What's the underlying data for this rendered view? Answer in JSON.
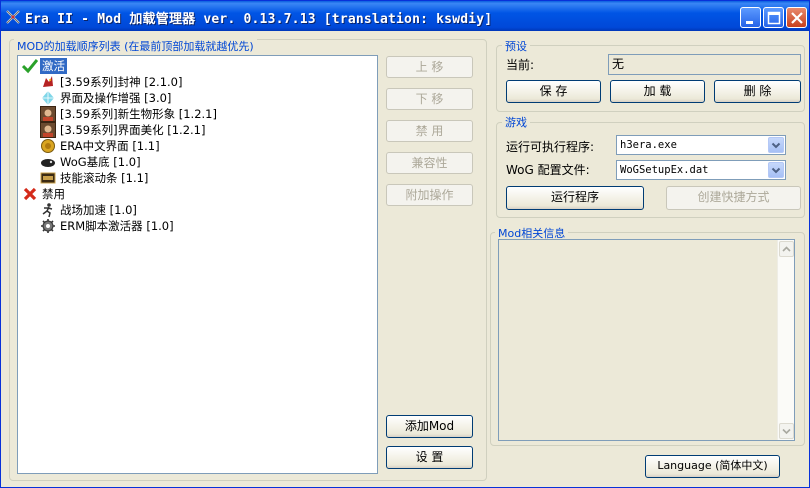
{
  "window": {
    "title": "Era II - Mod 加载管理器 ver. 0.13.7.13 [translation: kswdiy]"
  },
  "mod_list": {
    "group_label": "MOD的加载顺序列表 (在最前顶部加载就越优先)",
    "active": {
      "label": "激活",
      "icon": "green-check-icon",
      "items": [
        {
          "label": "[3.59系列]封神 [2.1.0]",
          "icon": "dragon-icon"
        },
        {
          "label": "界面及操作增强 [3.0]",
          "icon": "crystal-icon"
        },
        {
          "label": "[3.59系列]新生物形象 [1.2.1]",
          "icon": "portrait-icon"
        },
        {
          "label": "[3.59系列]界面美化 [1.2.1]",
          "icon": "portrait-icon"
        },
        {
          "label": "ERA中文界面 [1.1]",
          "icon": "gold-coin-icon"
        },
        {
          "label": "WoG基底 [1.0]",
          "icon": "dark-creature-icon"
        },
        {
          "label": "技能滚动条 [1.1]",
          "icon": "scroll-bar-icon"
        }
      ]
    },
    "disabled": {
      "label": "禁用",
      "icon": "red-x-icon",
      "items": [
        {
          "label": "战场加速 [1.0]",
          "icon": "running-man-icon"
        },
        {
          "label": "ERM脚本激活器 [1.0]",
          "icon": "gear-icon"
        }
      ]
    }
  },
  "actions": {
    "move_up": "上 移",
    "move_down": "下 移",
    "disable": "禁 用",
    "compatibility": "兼容性",
    "extra": "附加操作",
    "add_mod": "添加Mod",
    "settings": "设 置"
  },
  "presets": {
    "group_label": "预设",
    "current_label": "当前:",
    "current_value": "无",
    "save": "保 存",
    "load": "加 载",
    "delete": "删 除"
  },
  "game": {
    "group_label": "游戏",
    "exe_label": "运行可执行程序:",
    "exe_value": "h3era.exe",
    "wog_label": "WoG 配置文件:",
    "wog_value": "WoGSetupEx.dat",
    "run": "运行程序",
    "shortcut": "创建快捷方式"
  },
  "info": {
    "group_label": "Mod相关信息"
  },
  "language_button": "Language (简体中文)"
}
